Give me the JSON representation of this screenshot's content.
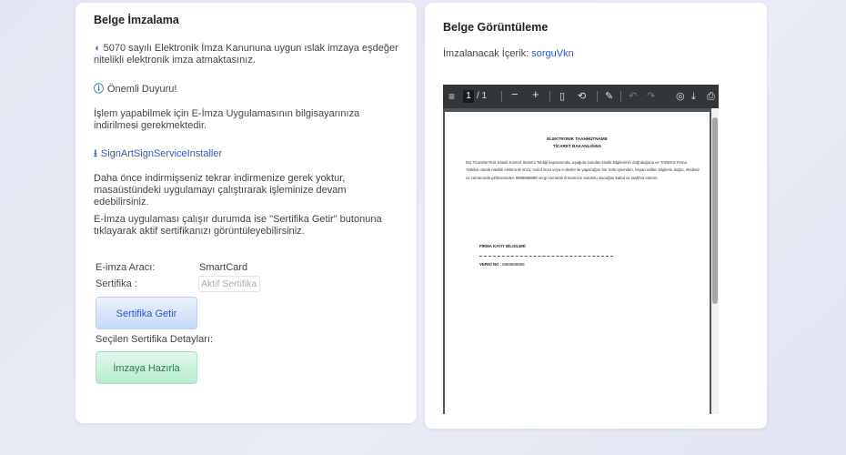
{
  "left": {
    "title": "Belge İmzalama",
    "law_text": "5070 sayılı Elektronik İmza Kanununa uygun ıslak imzaya eşdeğer nitelikli elektronik imza atmaktasınız.",
    "notice_title": "Önemli Duyuru!",
    "install_text": "İşlem yapabilmek için E-İmza Uygulamasının bilgisayarınıza indirilmesi gerekmektedir.",
    "download_link": "SignArtSignServiceInstaller",
    "no_reinstall_text": "Daha önce indirmişseniz tekrar indirmenize gerek yoktur, masaüstündeki uygulamayı çalıştırarak işleminize devam edebilirsiniz.",
    "running_text": "E-İmza uygulaması çalışır durumda ise \"Sertifika Getir\" butonuna tıklayarak aktif sertifikanızı görüntüleyebilirsiniz.",
    "tool_label": "E-imza Aracı:",
    "tool_value": "SmartCard",
    "cert_label": "Sertifika :",
    "cert_select": "Aktif Sertifika",
    "get_cert_button": "Sertifika Getir",
    "selected_details_label": "Seçilen Sertifika Detayları:",
    "sign_button": "İmzaya Hazırla",
    "icons": {
      "law": "shield-icon",
      "notice": "info-icon",
      "download": "download-icon"
    }
  },
  "right": {
    "title": "Belge Görüntüleme",
    "content_label": "İmzalanacak İçerik:",
    "content_name": "sorguVkn",
    "viewer": {
      "page_current": "1",
      "page_total": "/ 1",
      "toolbar_icons": [
        "menu-icon",
        "zoom-out-icon",
        "zoom-in-icon",
        "fit-page-icon",
        "rotate-icon",
        "draw-icon",
        "undo-icon",
        "redo-icon",
        "annotation-icon",
        "download-icon",
        "print-icon",
        "more-icon"
      ]
    },
    "document": {
      "title1": "ELEKTRONİK TAAHHÜTNAME",
      "title2": "TİCARET BAKANLIĞINA",
      "body": "Dış Ticarette Risk Esaslı Kontrol Sistemi Tebliği kapsamında, aşağıda sunulan kimlik bilgilerimin doğruluğunu ve TAREKS Firma Yetkilisi olarak nitelikli elektronik imza, mobil imza veya e-devlet ile yapacağım her türlü işlemden, beyan edilen bilgilerin doğru, eksiksiz ve zamanında girilmesinden 8888888888 vergi numaralı firmamızın sorumlu olacağını kabul ve taahhüt ederim.",
      "section": "FİRMA KAYIT BİLGİLERİ",
      "vergi_label": "VERGİ NO",
      "vergi_value": ": 8888888888"
    }
  }
}
